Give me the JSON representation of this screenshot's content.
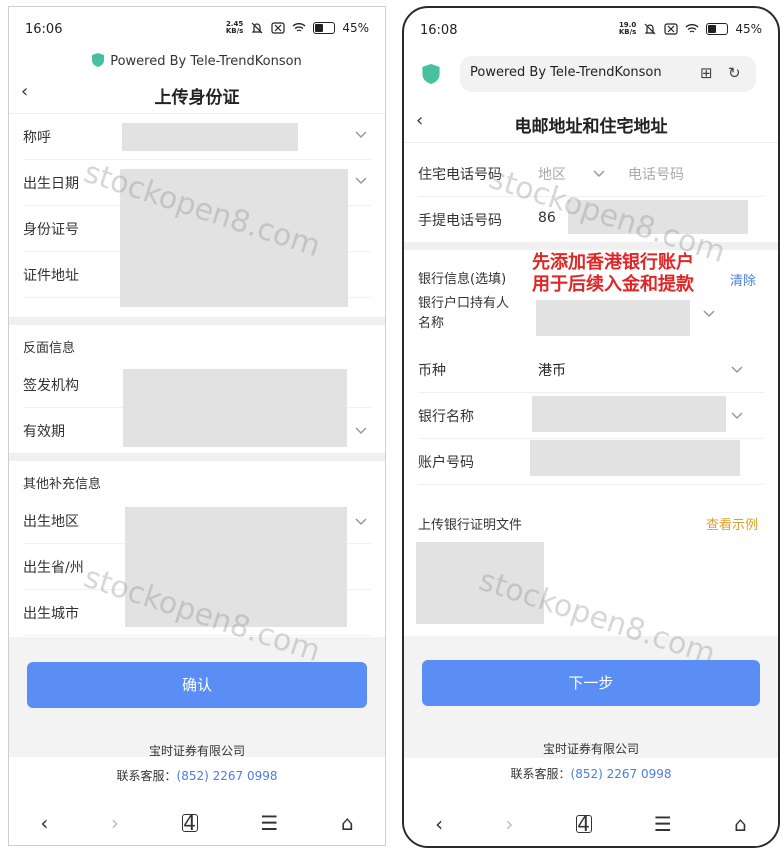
{
  "left": {
    "status": {
      "time": "16:06",
      "speed_top": "2.45",
      "speed_bottom": "KB/s",
      "battery": "45%"
    },
    "powered_by": "Powered By Tele-TrendKonson",
    "header": {
      "back": "‹",
      "title": "上传身份证"
    },
    "fields": [
      {
        "label": "称呼"
      },
      {
        "label": "出生日期"
      },
      {
        "label": "身份证号"
      },
      {
        "label": "证件地址"
      }
    ],
    "section_back": "反面信息",
    "back_fields": [
      {
        "label": "签发机构"
      },
      {
        "label": "有效期"
      }
    ],
    "section_other": "其他补充信息",
    "other_fields": [
      {
        "label": "出生地区"
      },
      {
        "label": "出生省/州"
      },
      {
        "label": "出生城市"
      }
    ],
    "confirm": "确认",
    "company": "宝时证券有限公司",
    "service_label": "联系客服：",
    "service_phone": "(852) 2267 0998",
    "nav": {
      "back": "‹",
      "forward": "›",
      "tabs": "4",
      "menu": "☰",
      "home": "⌂"
    },
    "watermark": "stockopen8.com"
  },
  "right": {
    "status": {
      "time": "16:08",
      "speed_top": "19.0",
      "speed_bottom": "KB/s",
      "battery": "45%"
    },
    "url": "Powered By Tele-TrendKonson",
    "header": {
      "back": "‹",
      "title": "电邮地址和住宅地址"
    },
    "home_phone": {
      "label": "住宅电话号码",
      "region_placeholder": "地区",
      "phone_placeholder": "电话号码"
    },
    "mobile": {
      "label": "手提电话号码",
      "code": "86"
    },
    "bank_section": "银行信息(选填)",
    "clear": "清除",
    "note_line1": "先添加香港银行账户",
    "note_line2": "用于后续入金和提款",
    "holder_label_1": "银行户口持有人",
    "holder_label_2": "名称",
    "currency": {
      "label": "币种",
      "value": "港币"
    },
    "bank_name": {
      "label": "银行名称"
    },
    "account": {
      "label": "账户号码"
    },
    "upload": {
      "label": "上传银行证明文件",
      "example": "查看示例"
    },
    "next": "下一步",
    "company": "宝时证券有限公司",
    "service_label": "联系客服：",
    "service_phone": "(852) 2267 0998",
    "nav": {
      "back": "‹",
      "forward": "›",
      "tabs": "4",
      "menu": "☰",
      "home": "⌂"
    },
    "watermark": "stockopen8.com"
  },
  "colors": {
    "primary": "#5b8ef4",
    "link": "#4a7de0",
    "orange": "#e0a030",
    "red_note": "#e02626",
    "placeholder": "#e2e2e2"
  }
}
